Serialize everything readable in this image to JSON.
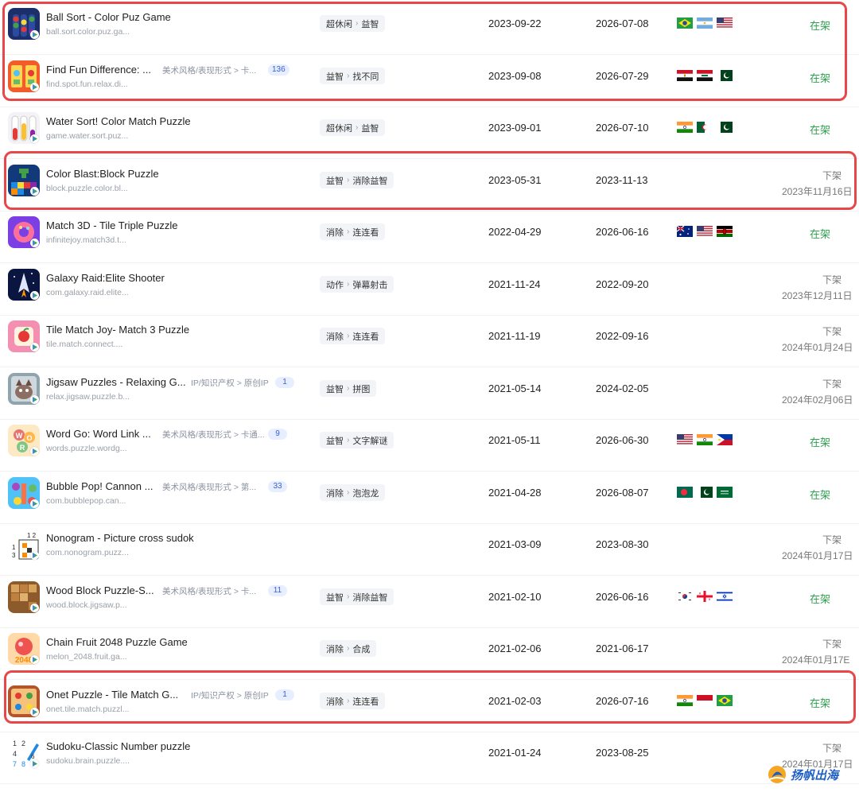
{
  "apps": [
    {
      "name": "Ball Sort - Color Puz Game",
      "package": "ball.sort.color.puz.ga...",
      "icon": "ball-sort-icon",
      "categories": [
        "超休闲",
        "益智"
      ],
      "release_date": "2023-09-22",
      "update_date": "2026-07-08",
      "regions": [
        "brazil-flag",
        "argentina-flag",
        "usa-flag"
      ],
      "status": "在架"
    },
    {
      "name": "Find Fun Difference: ...",
      "package": "find.spot.fun.relax.di...",
      "icon": "find-difference-icon",
      "attribute": "美术风格/表现形式 > 卡...",
      "attribute_count": "136",
      "categories": [
        "益智",
        "找不同"
      ],
      "release_date": "2023-09-08",
      "update_date": "2026-07-29",
      "regions": [
        "egypt-flag",
        "iraq-flag",
        "pakistan-flag"
      ],
      "status": "在架"
    },
    {
      "name": "Water Sort! Color Match Puzzle",
      "package": "game.water.sort.puz...",
      "icon": "water-sort-icon",
      "categories": [
        "超休闲",
        "益智"
      ],
      "release_date": "2023-09-01",
      "update_date": "2026-07-10",
      "regions": [
        "india-flag",
        "algeria-flag",
        "pakistan-flag"
      ],
      "status": "在架"
    },
    {
      "name": "Color Blast:Block Puzzle",
      "package": "block.puzzle.color.bl...",
      "icon": "color-blast-icon",
      "categories": [
        "益智",
        "消除益智"
      ],
      "release_date": "2023-05-31",
      "update_date": "2023-11-13",
      "regions": [],
      "status": "下架",
      "delist_date": "2023年11月16日"
    },
    {
      "name": "Match 3D - Tile Triple Puzzle",
      "package": "infinitejoy.match3d.t...",
      "icon": "match-3d-icon",
      "categories": [
        "消除",
        "连连看"
      ],
      "release_date": "2022-04-29",
      "update_date": "2026-06-16",
      "regions": [
        "australia-flag",
        "usa-flag",
        "kenya-flag"
      ],
      "status": "在架"
    },
    {
      "name": "Galaxy Raid:Elite Shooter",
      "package": "com.galaxy.raid.elite...",
      "icon": "galaxy-raid-icon",
      "categories": [
        "动作",
        "弹幕射击"
      ],
      "release_date": "2021-11-24",
      "update_date": "2022-09-20",
      "regions": [],
      "status": "下架",
      "delist_date": "2023年12月11日"
    },
    {
      "name": "Tile Match Joy- Match 3 Puzzle",
      "package": "tile.match.connect....",
      "icon": "tile-match-joy-icon",
      "categories": [
        "消除",
        "连连看"
      ],
      "release_date": "2021-11-19",
      "update_date": "2022-09-16",
      "regions": [],
      "status": "下架",
      "delist_date": "2024年01月24日"
    },
    {
      "name": "Jigsaw Puzzles - Relaxing G...",
      "package": "relax.jigsaw.puzzle.b...",
      "icon": "jigsaw-cat-icon",
      "attribute": "IP/知识产权 > 原创IP",
      "attribute_count": "1",
      "categories": [
        "益智",
        "拼图"
      ],
      "release_date": "2021-05-14",
      "update_date": "2024-02-05",
      "regions": [],
      "status": "下架",
      "delist_date": "2024年02月06日"
    },
    {
      "name": "Word Go: Word Link ...",
      "package": "words.puzzle.wordg...",
      "icon": "word-go-icon",
      "attribute": "美术风格/表现形式 > 卡通...",
      "attribute_count": "9",
      "categories": [
        "益智",
        "文字解谜"
      ],
      "release_date": "2021-05-11",
      "update_date": "2026-06-30",
      "regions": [
        "usa-flag",
        "india-flag",
        "philippines-flag"
      ],
      "status": "在架"
    },
    {
      "name": "Bubble Pop! Cannon ...",
      "package": "com.bubblepop.can...",
      "icon": "bubble-pop-icon",
      "attribute": "美术风格/表现形式 > 第...",
      "attribute_count": "33",
      "categories": [
        "消除",
        "泡泡龙"
      ],
      "release_date": "2021-04-28",
      "update_date": "2026-08-07",
      "regions": [
        "bangladesh-flag",
        "pakistan-flag",
        "saudi-arabia-flag"
      ],
      "status": "在架"
    },
    {
      "name": "Nonogram - Picture cross sudok",
      "package": "com.nonogram.puzz...",
      "icon": "nonogram-icon",
      "categories": [],
      "release_date": "2021-03-09",
      "update_date": "2023-08-30",
      "regions": [],
      "status": "下架",
      "delist_date": "2024年01月17日"
    },
    {
      "name": "Wood Block Puzzle-S...",
      "package": "wood.block.jigsaw.p...",
      "icon": "wood-block-icon",
      "attribute": "美术风格/表现形式 > 卡...",
      "attribute_count": "11",
      "categories": [
        "益智",
        "消除益智"
      ],
      "release_date": "2021-02-10",
      "update_date": "2026-06-16",
      "regions": [
        "south-korea-flag",
        "georgia-flag",
        "israel-flag"
      ],
      "status": "在架"
    },
    {
      "name": "Chain Fruit 2048 Puzzle Game",
      "package": "melon_2048.fruit.ga...",
      "icon": "chain-fruit-icon",
      "categories": [
        "消除",
        "合成"
      ],
      "release_date": "2021-02-06",
      "update_date": "2021-06-17",
      "regions": [],
      "status": "下架",
      "delist_date": "2024年01月17E"
    },
    {
      "name": "Onet Puzzle - Tile Match G...",
      "package": "onet.tile.match.puzzl...",
      "icon": "onet-puzzle-icon",
      "attribute": "IP/知识产权 > 原创IP",
      "attribute_count": "1",
      "categories": [
        "消除",
        "连连看"
      ],
      "release_date": "2021-02-03",
      "update_date": "2026-07-16",
      "regions": [
        "india-flag",
        "indonesia-flag",
        "brazil-flag"
      ],
      "status": "在架"
    },
    {
      "name": "Sudoku-Classic Number puzzle",
      "package": "sudoku.brain.puzzle....",
      "icon": "sudoku-icon",
      "categories": [],
      "release_date": "2021-01-24",
      "update_date": "2023-08-25",
      "regions": [],
      "status": "下架",
      "delist_date": "2024年01月17日"
    }
  ],
  "colors": {
    "status_on": "#2ba14b",
    "status_off": "#777777",
    "highlight": "#e8474a",
    "count_badge_bg": "#e6eeff",
    "count_badge_text": "#3b5fd6"
  },
  "watermark": {
    "text": "扬帆出海",
    "icon": "sail-logo-icon"
  }
}
